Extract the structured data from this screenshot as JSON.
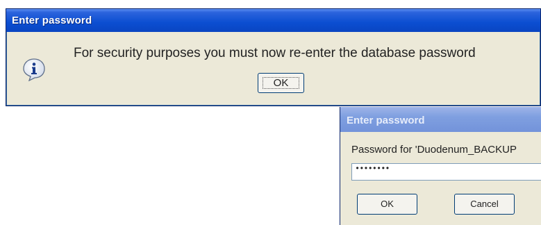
{
  "dialog1": {
    "title": "Enter password",
    "icon": "info-icon",
    "message": "For security purposes you must now re-enter the database password",
    "ok_label": "OK"
  },
  "dialog2": {
    "title": "Enter password",
    "prompt": "Password for 'Duodenum_BACKUP",
    "password_value": "••••••••",
    "ok_label": "OK",
    "cancel_label": "Cancel"
  },
  "colors": {
    "title_active": "#0a45c2",
    "title_inactive": "#7f9fe0",
    "dialog_bg": "#ece9d8"
  }
}
